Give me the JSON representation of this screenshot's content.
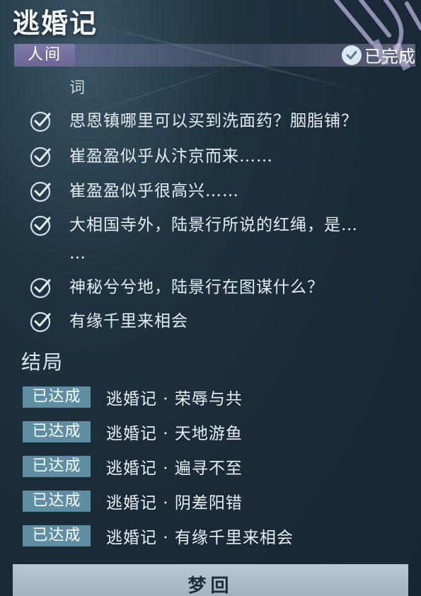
{
  "header": {
    "title": "逃婚记",
    "tag": "人间",
    "status_label": "已完成",
    "status_icon": "check-circle-icon"
  },
  "clues": {
    "section_label": "词",
    "items": [
      {
        "text": "思恩镇哪里可以买到洗面药？胭脂铺？",
        "done": true
      },
      {
        "text": "崔盈盈似乎从汴京而来……",
        "done": true
      },
      {
        "text": "崔盈盈似乎很高兴……",
        "done": true
      },
      {
        "text": "大相国寺外，陆景行所说的红绳，是…",
        "continuation": "…",
        "done": true
      },
      {
        "text": "神秘兮兮地，陆景行在图谋什么？",
        "done": true
      },
      {
        "text": "有缘千里来相会",
        "done": true
      }
    ]
  },
  "endings": {
    "title": "结局",
    "items": [
      {
        "badge": "已达成",
        "text": "逃婚记 · 荣辱与共"
      },
      {
        "badge": "已达成",
        "text": "逃婚记 · 天地游鱼"
      },
      {
        "badge": "已达成",
        "text": "逃婚记 · 遍寻不至"
      },
      {
        "badge": "已达成",
        "text": "逃婚记 · 阴差阳错"
      },
      {
        "badge": "已达成",
        "text": "逃婚记 · 有缘千里来相会"
      }
    ]
  },
  "footer": {
    "button_label": "梦回"
  },
  "colors": {
    "background": "#1a2b37",
    "tag_bg": "#6b6794",
    "badge_bg": "#5d8ea3",
    "check": "#cfe0ea",
    "button_bg": "#b0bfcc"
  }
}
